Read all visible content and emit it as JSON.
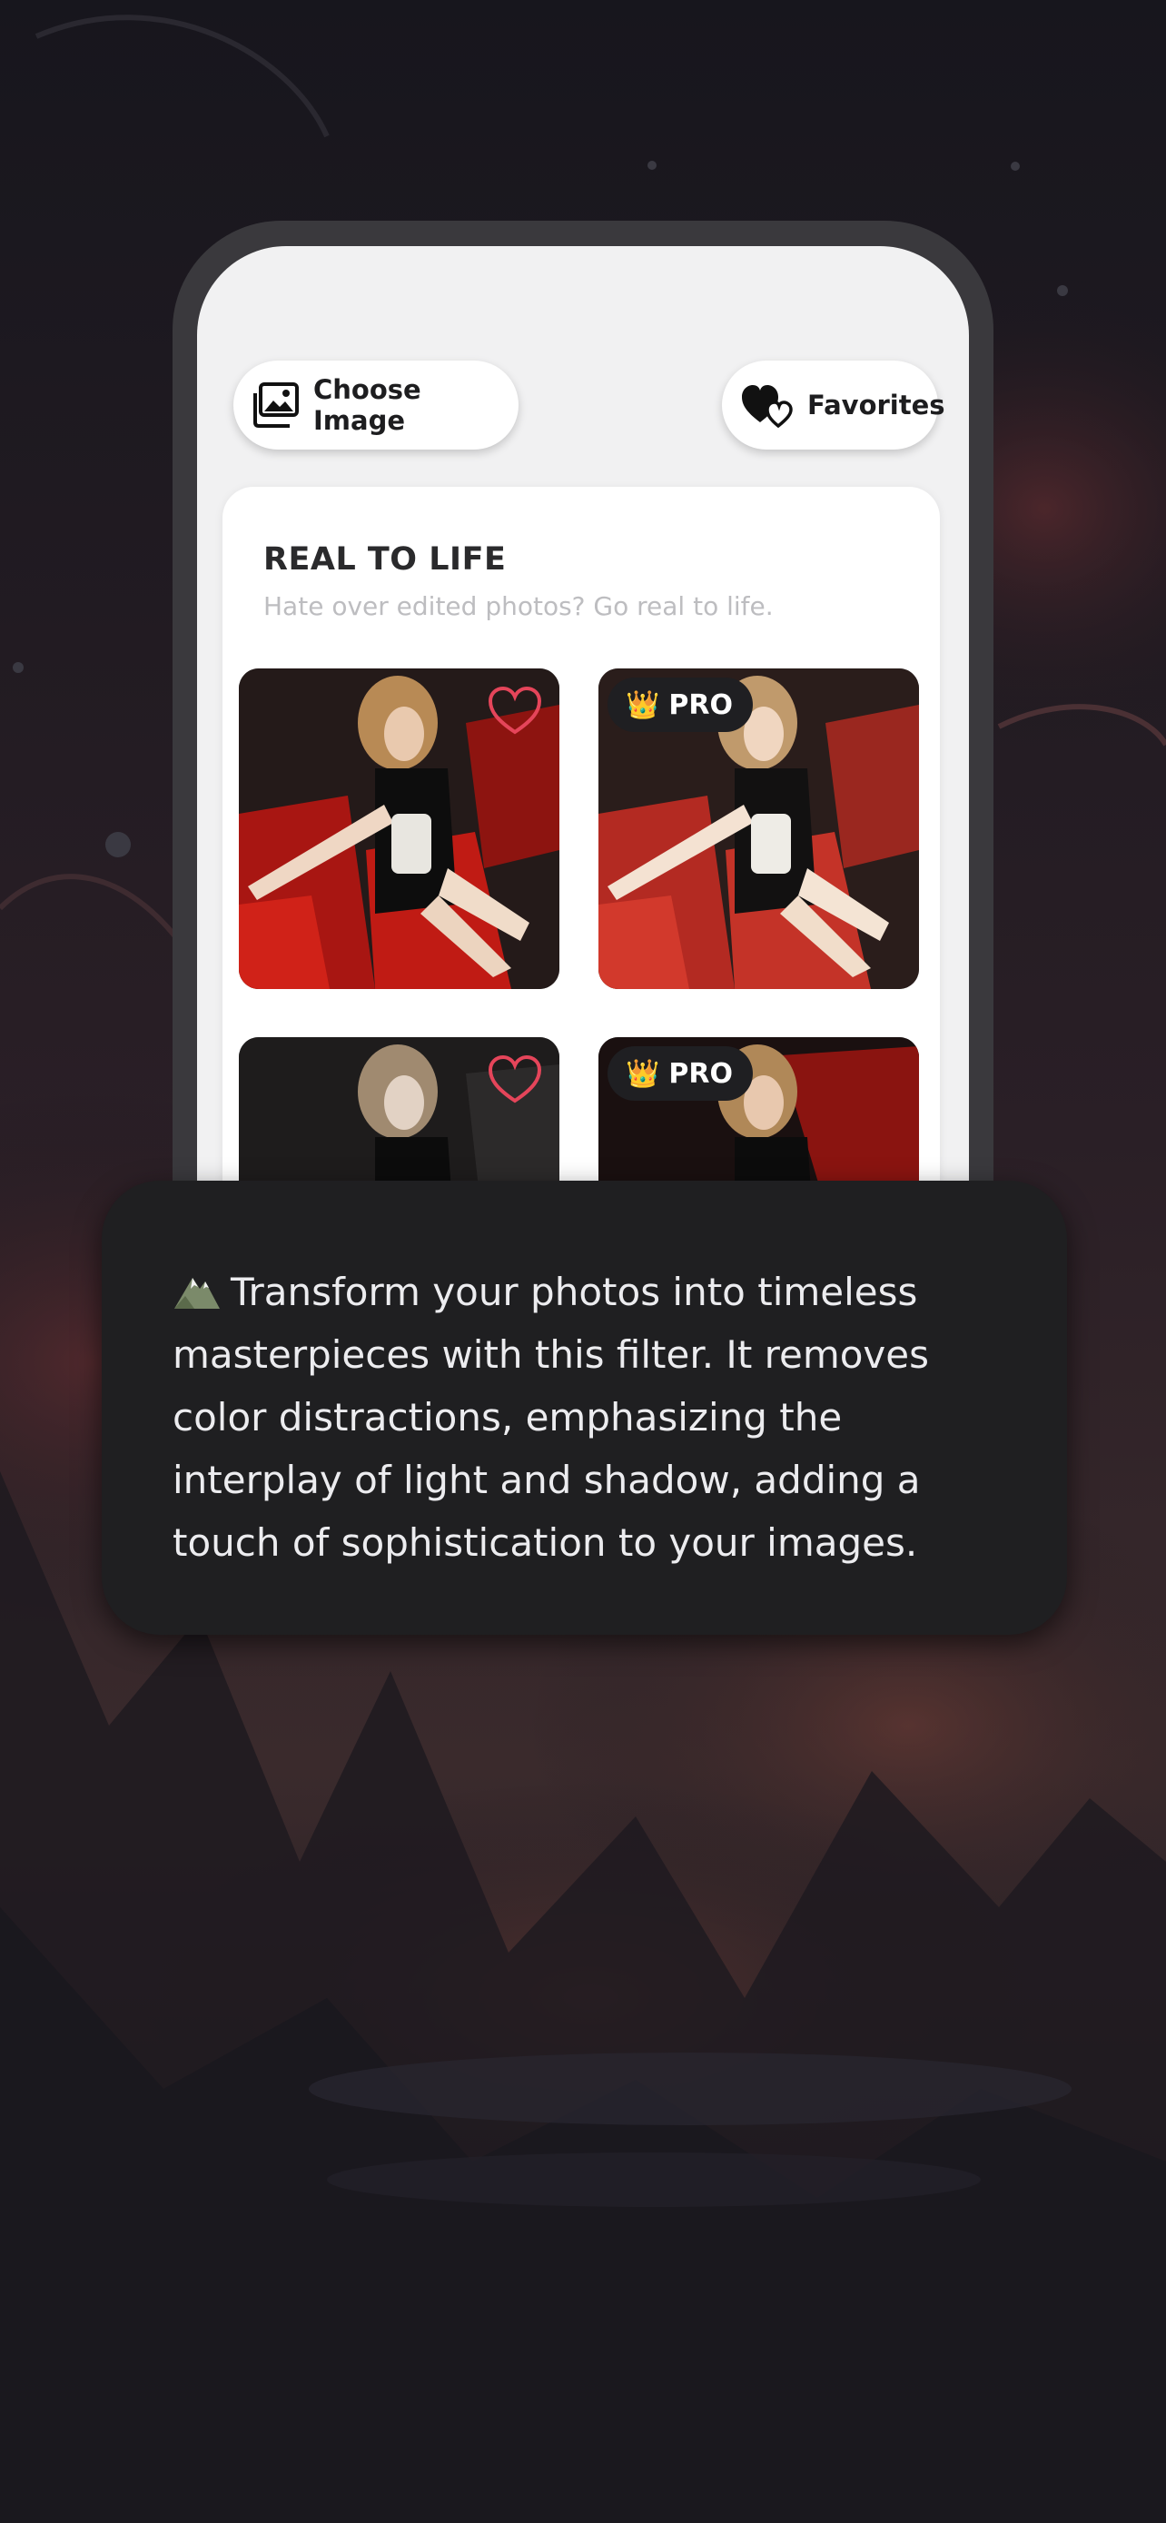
{
  "toolbar": {
    "choose_image_label": "Choose Image",
    "favorites_label": "Favorites"
  },
  "section": {
    "title": "REAL TO LIFE",
    "subtitle": "Hate over edited photos? Go real to life."
  },
  "filters": [
    {
      "badge": "",
      "favorited": false,
      "icon": "heart-outline-icon"
    },
    {
      "badge": "PRO",
      "crown_icon": "👑"
    },
    {
      "badge": "",
      "favorited": false,
      "icon": "heart-outline-icon"
    },
    {
      "badge": "PRO",
      "crown_icon": "👑"
    }
  ],
  "description": {
    "icon": "mountain-icon",
    "text": "Transform your photos into timeless masterpieces with this filter. It removes color distractions, emphasizing the interplay of light and shadow, adding a touch of sophistication to your images."
  },
  "colors": {
    "heart": "#e5455a",
    "background": "#17161d",
    "bubble": "#1f1f21"
  }
}
